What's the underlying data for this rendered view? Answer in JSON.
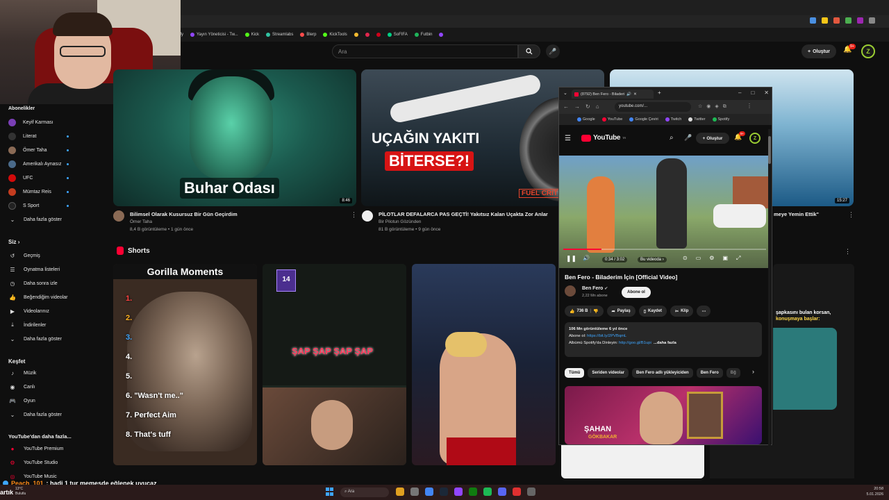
{
  "bookmarks": [
    "Yayın Yöneticisi - Tw...",
    "Kick",
    "Streamlabs",
    "Blerp",
    "KickTools",
    "SoFIFA",
    "Futbin"
  ],
  "bookmark_prefix": "ify",
  "header": {
    "search_placeholder": "Ara",
    "create_label": "Oluştur",
    "notif_badge": "9+",
    "avatar_letter": "Z"
  },
  "sidebar": {
    "subscriptions_header": "Abonelikler",
    "subscriptions": [
      {
        "label": "Keyif Karması"
      },
      {
        "label": "Literat"
      },
      {
        "label": "Ömer Taha"
      },
      {
        "label": "Amerikalı Aynasız"
      },
      {
        "label": "UFC"
      },
      {
        "label": "Mümtaz Reis"
      },
      {
        "label": "S Sport"
      },
      {
        "label": "Daha fazla göster"
      }
    ],
    "you_header": "Siz",
    "you_items": [
      {
        "label": "Geçmiş"
      },
      {
        "label": "Oynatma listeleri"
      },
      {
        "label": "Daha sonra izle"
      },
      {
        "label": "Beğendiğim videolar"
      },
      {
        "label": "Videolarınız"
      },
      {
        "label": "İndirilenler"
      },
      {
        "label": "Daha fazla göster"
      }
    ],
    "explore_header": "Keşfet",
    "explore_items": [
      {
        "label": "Müzik"
      },
      {
        "label": "Canlı"
      },
      {
        "label": "Oyun"
      },
      {
        "label": "Daha fazla göster"
      }
    ],
    "more_header": "YouTube'dan daha fazla...",
    "more_items": [
      {
        "label": "YouTube Premium"
      },
      {
        "label": "YouTube Studio"
      },
      {
        "label": "YouTube Music"
      }
    ]
  },
  "videos": [
    {
      "thumb_caption": "Buhar Odası",
      "duration": "8:46",
      "title": "Bilimsel Olarak Kusursuz Bir Gün Geçirdim",
      "channel": "Ömer Taha",
      "meta": "8,4 B görüntüleme • 1 gün önce"
    },
    {
      "thumb_caption_1": "UÇAĞIN YAKITI",
      "thumb_caption_2": "BİTERSE?!",
      "thumb_badge": "FUEL CRIT",
      "title": "PİLOTLAR DEFALARCA PAS GEÇTİ! Yakıtsız Kalan Uçakta Zor Anlar",
      "channel": "Bir Pilotun Gözünden",
      "meta": "81 B görüntüleme • 9 gün önce"
    },
    {
      "duration": "15:27",
      "title_fragment": "meye Yemin Ettik\""
    }
  ],
  "shorts": {
    "header": "Shorts",
    "s1_title": "Gorilla Moments",
    "s1_list": [
      "1.",
      "2.",
      "3.",
      "4.",
      "5.",
      "6. \"Wasn't me..\"",
      "7. Perfect Aim",
      "8. That's tuff"
    ],
    "s2_level": "14",
    "s2_caption": "ŞAP ŞAP ŞAP ŞAP",
    "s4_text_1": "şapkasını bulan korsan,",
    "s4_text_2": "konuşmaya başlar:"
  },
  "popup": {
    "tab_title": "(8792) Ben Fero - Biladeri",
    "url": "youtube.com/...",
    "bookmarks": [
      "Google",
      "YouTube",
      "Google Çeviri",
      "Twitch",
      "Twitter",
      "Spotify"
    ],
    "yt_logo": "YouTube",
    "yt_region": "TR",
    "create_label": "Oluştur",
    "notif_badge": "9+",
    "avatar_letter": "Z",
    "player": {
      "time": "0:34 / 3:02",
      "chapter": "Bu videoda",
      "progress": 0.19
    },
    "title": "Ben Fero - Biladerim İçin [Official Video]",
    "channel": "Ben Fero",
    "subs": "2,22 Mn abone",
    "subscribe": "Abone ol",
    "actions": {
      "likes": "736 B",
      "share": "Paylaş",
      "save": "Kaydet",
      "clip": "Klip"
    },
    "desc_meta": "106 Mn görüntüleme  6 yıl önce",
    "desc_line2_prefix": "Abone ol:",
    "desc_link1": "https://bit.ly/2PVBqmL",
    "desc_line3_prefix": "Albümü Spotify'da Dinleyin:",
    "desc_link2": "http://goo.gl/B1upi",
    "desc_more": "...daha fazla",
    "chips": [
      "Tümü",
      "Seriden videolar",
      "Ben Fero adlı yükleyiciden",
      "Ben Fero",
      "Bğ"
    ],
    "next_thumb_1": "ŞAHAN",
    "next_thumb_2": "GÖKBAKAR"
  },
  "chat": {
    "user": "Peach_101",
    "message": ": hadi 1 tur memesde eğlenek uyucaz"
  },
  "overlay_word": "artık",
  "taskbar": {
    "weather_temp": "13°C",
    "weather_desc": "Bulutlu",
    "search": "Ara",
    "time": "20:58",
    "date": "5.01.2026"
  }
}
